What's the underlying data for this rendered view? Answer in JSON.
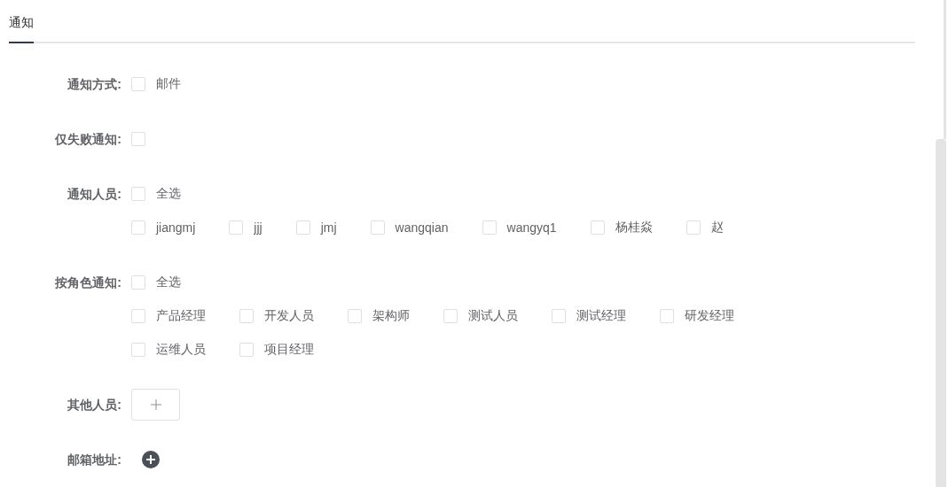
{
  "tabs": [
    {
      "label": "通知",
      "selected": true
    }
  ],
  "fields": [
    {
      "kind": "options",
      "label": "通知方式:",
      "options": [
        {
          "label": "邮件",
          "checked": false
        }
      ]
    },
    {
      "kind": "single",
      "label": "仅失败通知:",
      "checked": false
    },
    {
      "kind": "group",
      "label": "通知人员:",
      "select_all": {
        "label": "全选",
        "checked": false
      },
      "options": [
        {
          "label": "jiangmj",
          "checked": false
        },
        {
          "label": "jjj",
          "checked": false
        },
        {
          "label": "jmj",
          "checked": false
        },
        {
          "label": "wangqian",
          "checked": false
        },
        {
          "label": "wangyq1",
          "checked": false
        },
        {
          "label": "杨桂焱",
          "checked": false
        },
        {
          "label": "赵",
          "checked": false
        }
      ]
    },
    {
      "kind": "group",
      "label": "按角色通知:",
      "select_all": {
        "label": "全选",
        "checked": false
      },
      "options": [
        {
          "label": "产品经理",
          "checked": false
        },
        {
          "label": "开发人员",
          "checked": false
        },
        {
          "label": "架构师",
          "checked": false
        },
        {
          "label": "测试人员",
          "checked": false
        },
        {
          "label": "测试经理",
          "checked": false
        },
        {
          "label": "研发经理",
          "checked": false
        },
        {
          "label": "运维人员",
          "checked": false
        },
        {
          "label": "项目经理",
          "checked": false
        }
      ]
    },
    {
      "kind": "add_box",
      "label": "其他人员:"
    },
    {
      "kind": "add_icon",
      "label": "邮箱地址:"
    }
  ]
}
